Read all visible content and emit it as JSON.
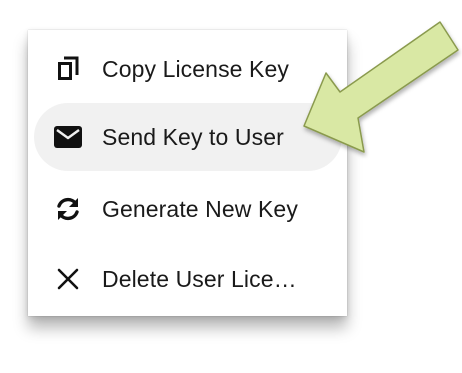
{
  "menu": {
    "items": [
      {
        "label": "Copy License Key",
        "icon": "copy-icon",
        "highlighted": false
      },
      {
        "label": "Send Key to User",
        "icon": "envelope-icon",
        "highlighted": true
      },
      {
        "label": "Generate New Key",
        "icon": "refresh-icon",
        "highlighted": false
      },
      {
        "label": "Delete User Lice…",
        "icon": "close-icon",
        "highlighted": false
      }
    ]
  },
  "annotation": {
    "icon": "pointer-arrow-icon",
    "fill_color": "#d9e8a4",
    "stroke_color": "#8a9a4e"
  },
  "colors": {
    "menu_background": "#ffffff",
    "highlight_background": "#f1f1f1",
    "text": "#1a1a1a"
  }
}
